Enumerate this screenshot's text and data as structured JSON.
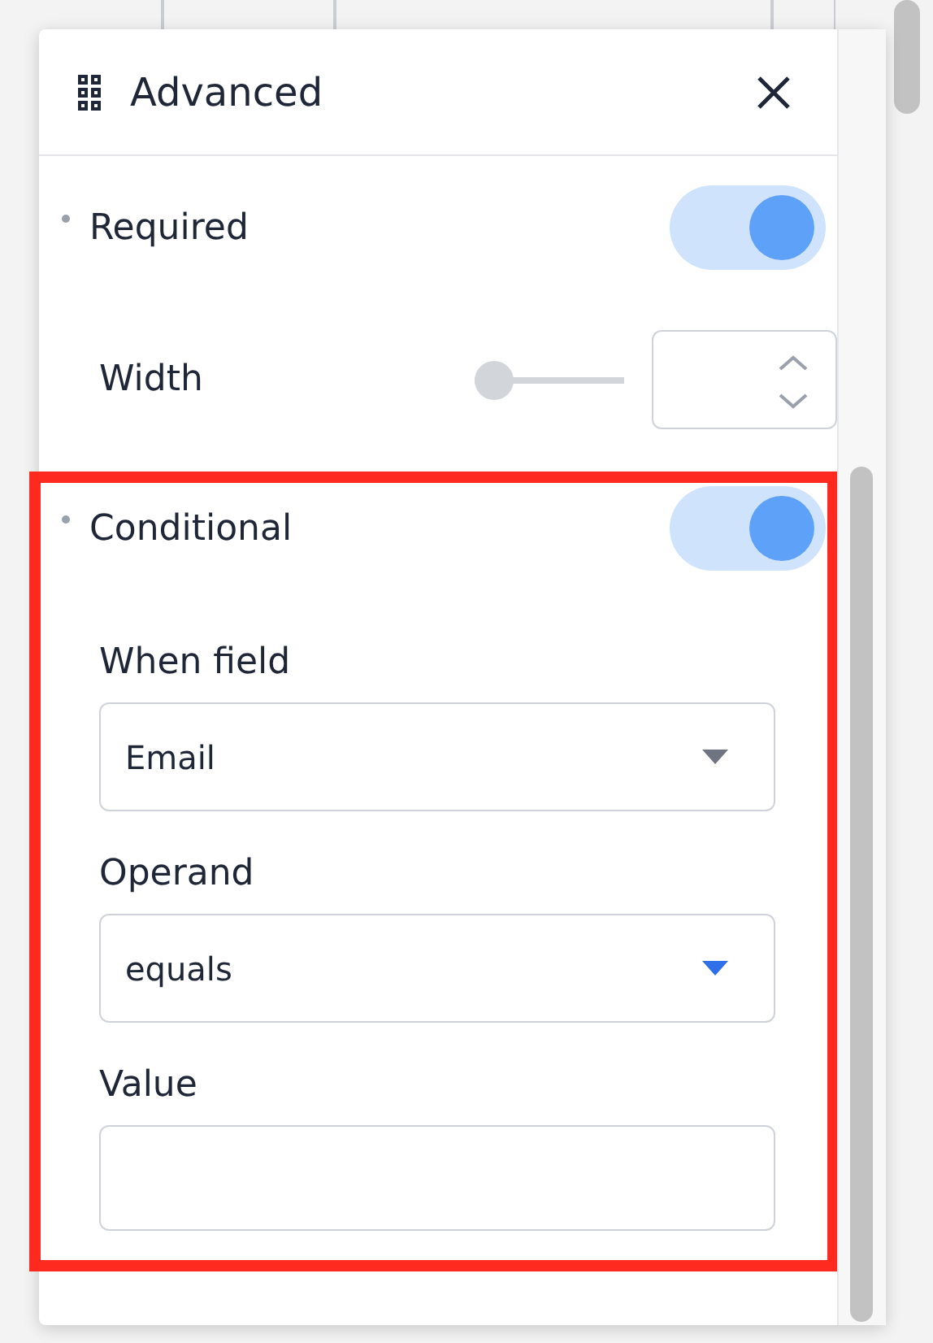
{
  "panel": {
    "title": "Advanced",
    "rows": [
      {
        "kind": "toggle",
        "label": "Required",
        "on": true
      },
      {
        "kind": "width",
        "label": "Width",
        "level": 0
      }
    ],
    "conditional": {
      "highlighted": true,
      "row": {
        "kind": "toggle",
        "label": "Conditional",
        "on": true
      },
      "fields": [
        {
          "kind": "select",
          "label": "When field",
          "value": "Email",
          "focused": false
        },
        {
          "kind": "select",
          "label": "Operand",
          "value": "equals",
          "focused": true
        },
        {
          "kind": "text",
          "label": "Value"
        }
      ]
    }
  }
}
